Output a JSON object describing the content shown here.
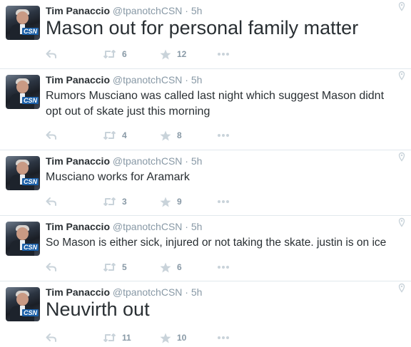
{
  "tweets": [
    {
      "name": "Tim Panaccio",
      "handle": "@tpanotchCSN",
      "dot": "·",
      "time": "5h",
      "logo": "CSN",
      "text": "Mason out for personal family matter",
      "retweets": "6",
      "favorites": "12"
    },
    {
      "name": "Tim Panaccio",
      "handle": "@tpanotchCSN",
      "dot": "·",
      "time": "5h",
      "logo": "CSN",
      "text": "Rumors Musciano was called last night which suggest Mason didnt",
      "text2": "opt out of skate just this morning",
      "retweets": "4",
      "favorites": "8"
    },
    {
      "name": "Tim Panaccio",
      "handle": "@tpanotchCSN",
      "dot": "·",
      "time": "5h",
      "logo": "CSN",
      "text": "Musciano works for Aramark",
      "retweets": "3",
      "favorites": "9"
    },
    {
      "name": "Tim Panaccio",
      "handle": "@tpanotchCSN",
      "dot": "·",
      "time": "5h",
      "logo": "CSN",
      "text": "So Mason is either sick, injured or not taking the skate. justin is on ice",
      "retweets": "5",
      "favorites": "6"
    },
    {
      "name": "Tim Panaccio",
      "handle": "@tpanotchCSN",
      "dot": "·",
      "time": "5h",
      "logo": "CSN",
      "text": "Neuvirth out",
      "retweets": "11",
      "favorites": "10"
    }
  ],
  "icons": {
    "reply": "reply-icon",
    "retweet": "retweet-icon",
    "favorite": "star-icon",
    "more": "more-icon",
    "caret": "location-pin-icon",
    "icon_color": "#c9d3da"
  }
}
